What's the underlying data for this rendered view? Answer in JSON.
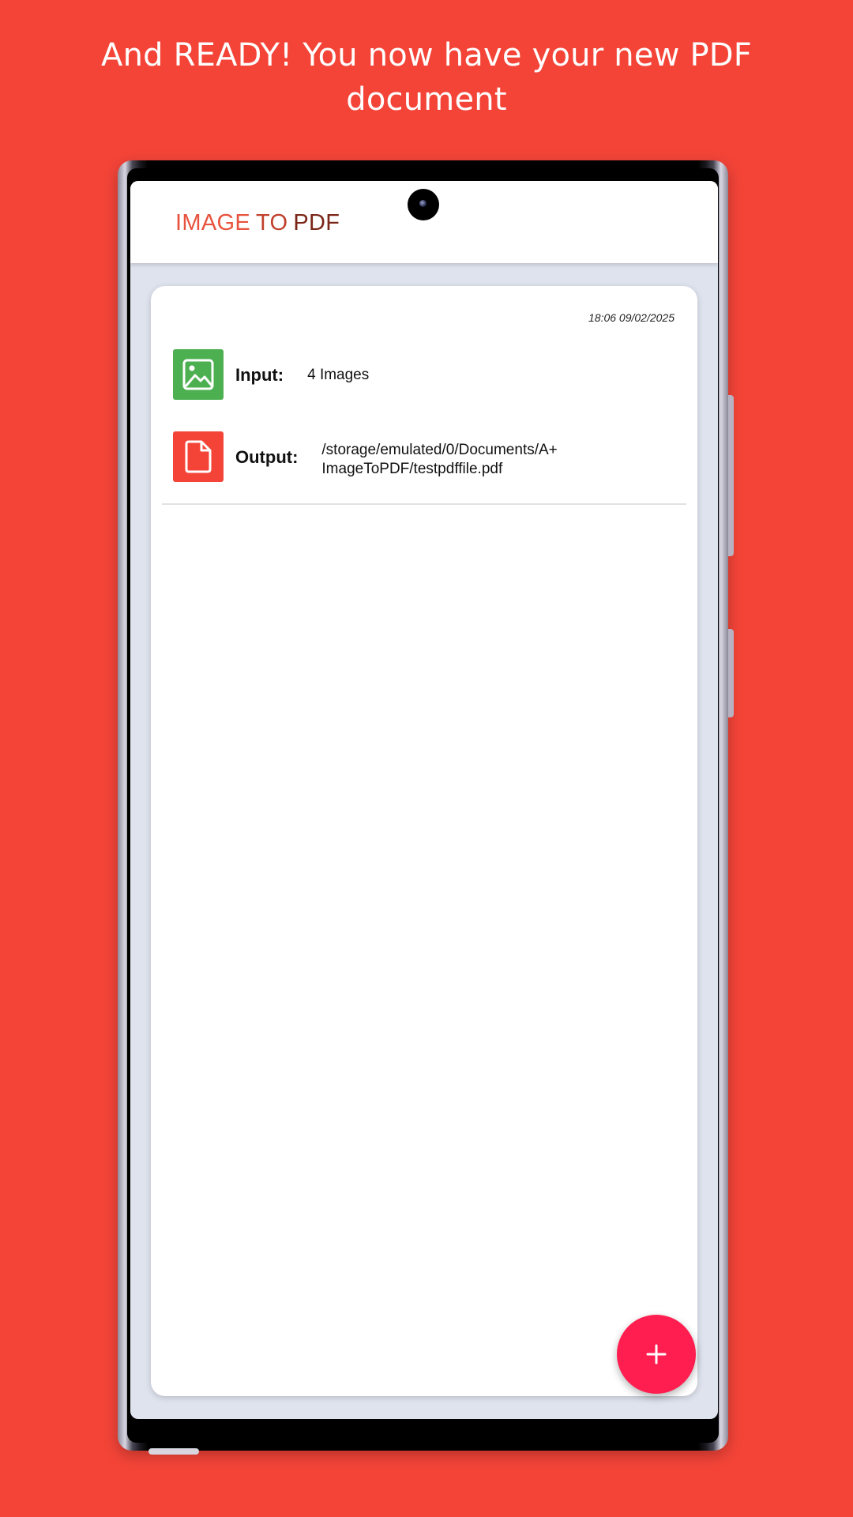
{
  "promo": {
    "headline": "And READY! You now have your new PDF document"
  },
  "app_bar": {
    "title_parts": [
      "IMAGE",
      "TO",
      "PDF"
    ]
  },
  "conversion_entry": {
    "timestamp": "18:06 09/02/2025",
    "input": {
      "icon": "image-icon",
      "label": "Input:",
      "value": "4 Images"
    },
    "output": {
      "icon": "file-icon",
      "label": "Output:",
      "value": "/storage/emulated/0/Documents/A+ ImageToPDF/testpdffile.pdf"
    }
  },
  "fab": {
    "icon": "plus-icon",
    "label": "+"
  },
  "colors": {
    "background": "#f44438",
    "input_icon_bg": "#4caf50",
    "output_icon_bg": "#f44438",
    "fab": "#ff1e4f"
  }
}
